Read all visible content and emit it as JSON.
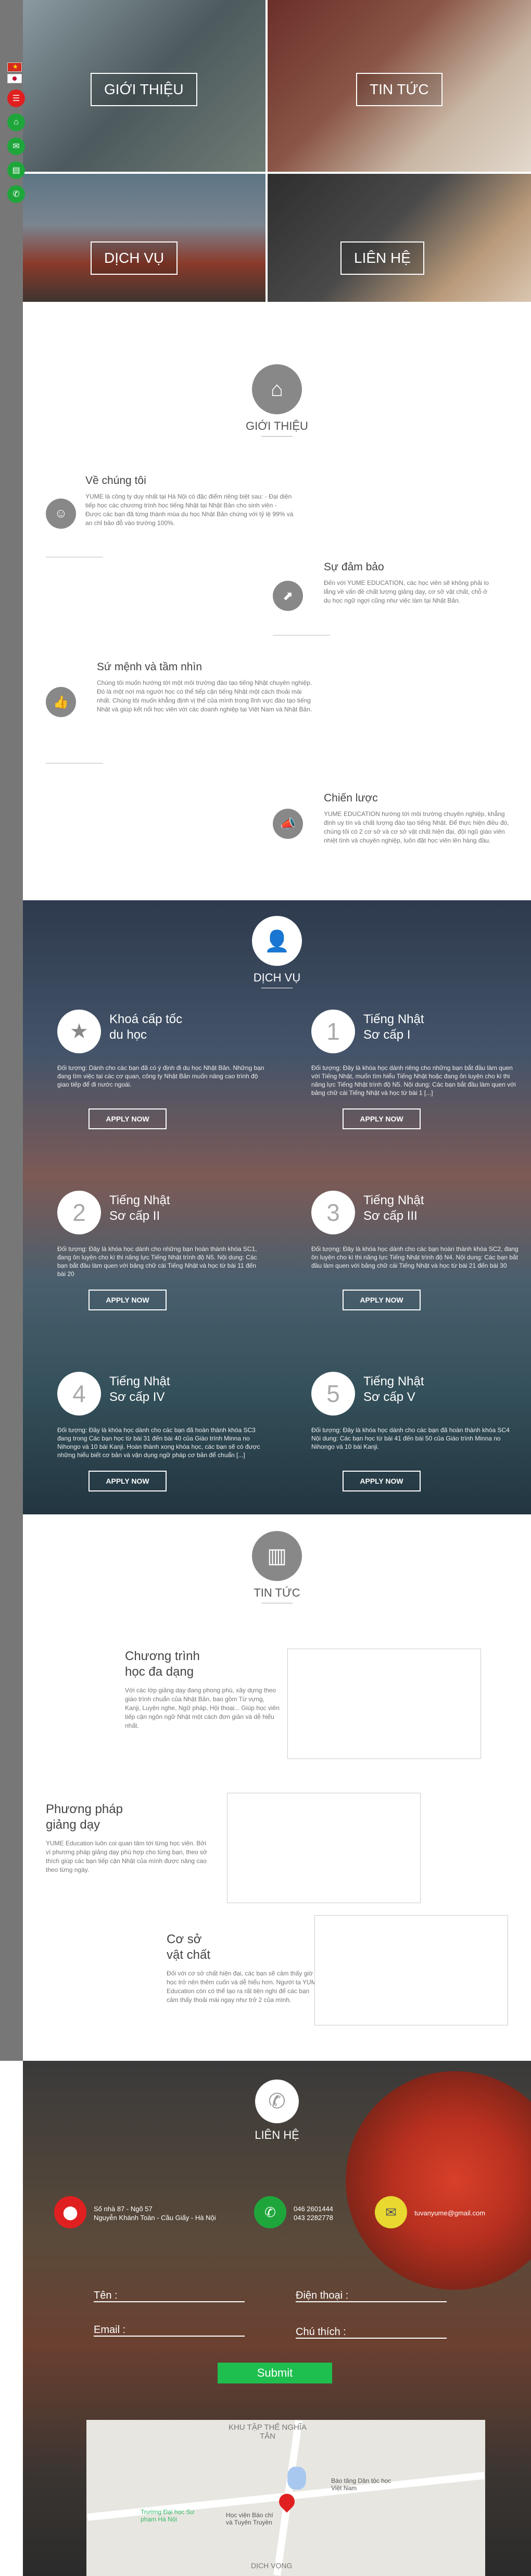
{
  "rail": {
    "icons": [
      "flag-vietnam",
      "flag-japan",
      "menu-icon",
      "home-icon",
      "mail-icon",
      "book-icon",
      "phone-icon"
    ]
  },
  "hero": {
    "tiles": [
      {
        "label": "GIỚI THIỆU"
      },
      {
        "label": "TIN TỨC"
      },
      {
        "label": "DỊCH VỤ"
      },
      {
        "label": "LIÊN HỆ"
      }
    ]
  },
  "about": {
    "title": "GIỚI THIỆU",
    "items": [
      {
        "title": "Về chúng tôi",
        "text": "YUME là công ty duy nhất tại Hà Nội có đặc điểm riêng biệt sau: - Đại diện tiếp học các chương trình học tiếng Nhật tại Nhật Bản cho sinh viên - Được các bạn đã từng thành mùa du học Nhật Bản chứng với tỷ lệ 99% và an chỉ bảo đỗ vào trường 100%."
      },
      {
        "title": "Sự đảm bảo",
        "text": "Đến với YUME EDUCATION, các học viên sẽ không phải lo lắng về vấn đề chất lượng giảng dạy, cơ sở vật chất, chỗ ở du học ngữ ngợi cũng như việc làm tại Nhật Bản."
      },
      {
        "title": "Sứ mệnh và tầm nhìn",
        "text": "Chúng tôi muốn hướng tới một môi trường đào tạo tiếng Nhật chuyên nghiệp. Đó là một nơi mà người học có thể tiếp cận tiếng Nhật một cách thoải mái nhất. Chúng tôi muốn khẳng định vị thế của mình trong lĩnh vực đào tạo tiếng Nhật và giúp kết nối học viên với các doanh nghiệp tại Việt Nam và Nhật Bản."
      },
      {
        "title": "Chiến lược",
        "text": "YUME EDUCATION hướng tới môi trường chuyên nghiệp, khẳng định uy tín và chất lượng đào tạo tiếng Nhật. Để thực hiện điều đó, chúng tôi có 2 cơ sở và cơ sở vật chất hiện đại, đội ngũ giáo viên nhiệt tình và chuyên nghiệp, luôn đặt học viên lên hàng đầu."
      }
    ]
  },
  "services": {
    "title": "DỊCH VỤ",
    "apply_label": "APPLY NOW",
    "items": [
      {
        "num": "★",
        "title_l1": "Khoá cấp tốc",
        "title_l2": "du học",
        "text": "Đối tượng: Dành cho các bạn đã có ý định đi du học Nhật Bản. Những bạn đang tìm việc tại các cơ quan, công ty Nhật Bản muốn nâng cao trình độ giao tiếp để đi nước ngoài."
      },
      {
        "num": "1",
        "title_l1": "Tiếng Nhật",
        "title_l2": "Sơ cấp I",
        "text": "Đối tượng: Đây là khóa học dành riêng cho những bạn bắt đầu làm quen với Tiếng Nhật, muốn tìm hiểu Tiếng Nhật hoặc đang ôn luyện cho kì thi năng lực Tiếng Nhật trình độ N5. Nội dung: Các bạn bắt đầu làm quen với bảng chữ cái Tiếng Nhật và học từ bài 1 [...]"
      },
      {
        "num": "2",
        "title_l1": "Tiếng Nhật",
        "title_l2": "Sơ cấp II",
        "text": "Đối tượng: Đây là khóa học dành cho những bạn hoàn thành khóa SC1, đang ôn luyện cho kì thi năng lực Tiếng Nhật trình độ N5. Nội dung: Các bạn bắt đầu làm quen với bảng chữ cái Tiếng Nhật và học từ bài 11 đến bài 20"
      },
      {
        "num": "3",
        "title_l1": "Tiếng Nhật",
        "title_l2": "Sơ cấp III",
        "text": "Đối tượng: Đây là khóa học dành cho các bạn hoàn thành khóa SC2, đang ôn luyện cho kì thi năng lực Tiếng Nhật trình độ N4. Nội dung: Các bạn bắt đầu làm quen với bảng chữ cái Tiếng Nhật và học từ bài 21 đến bài 30"
      },
      {
        "num": "4",
        "title_l1": "Tiếng Nhật",
        "title_l2": "Sơ cấp IV",
        "text": "Đối tượng: Đây là khóa học dành cho các bạn đã hoàn thành khóa SC3 đang trong Các bạn học từ bài 31 đến bài 40 của Giáo trình Minna no Nihongo và 10 bài Kanji. Hoàn thành xong khóa học, các bạn sẽ có được những hiểu biết cơ bản và vận dụng ngữ pháp cơ bản để chuẩn [...]"
      },
      {
        "num": "5",
        "title_l1": "Tiếng Nhật",
        "title_l2": "Sơ cấp V",
        "text": "Đối tượng: Đây là khóa học dành cho các bạn đã hoàn thành khóa SC4 Nội dung: Các bạn học từ bài 41 đến bài 50 của Giáo trình Minna no Nihongo và 10 bài Kanji."
      }
    ]
  },
  "news": {
    "title": "TIN TỨC",
    "items": [
      {
        "title_l1": "Chương trình",
        "title_l2": "học đa dạng",
        "text": "Với các lớp giảng dạy đang phong phú, xây dựng theo giáo trình chuẩn của Nhật Bản, bao gồm Từ vựng, Kanji, Luyện nghe, Ngữ pháp, Hội thoại... Giúp học viên tiếp cận ngôn ngữ Nhật một cách đơn giản và dễ hiểu nhất."
      },
      {
        "title_l1": "Phương pháp",
        "title_l2": "giảng dạy",
        "text": "YUME Education luôn coi quan tâm tới từng học viên. Bởi vì phương pháp giảng dạy phù hợp cho từng bạn, theo sở thích giúp các bạn tiếp cận Nhật của mình được nâng cao theo từng ngày."
      },
      {
        "title_l1": "Cơ sở",
        "title_l2": "vật chất",
        "text": "Đối với cơ sở chất hiện đại, các bạn sẽ cảm thấy giờ học trở nên thêm cuốn và dễ hiểu hơn. Người ta YUME Education còn có thể tạo ra rất tiện nghi để các bạn cảm thấy thoải mái ngay như trở 2 của mình."
      }
    ]
  },
  "contact": {
    "title": "LIÊN HỆ",
    "address_l1": "Số nhà 87 - Ngõ 57",
    "address_l2": "Nguyễn Khánh Toàn - Cầu Giấy - Hà Nội",
    "phone_l1": "046 2601444",
    "phone_l2": "043 2282778",
    "email": "tuvanyume@gmail.com",
    "name_label": "Tên :",
    "phone_label": "Điện thoại :",
    "email_label": "Email :",
    "note_label": "Chú thích :",
    "submit_label": "Submit",
    "map_labels": {
      "area": "KHU TẬP THỂ NGHĨA TÂN",
      "school": "Trường Đại học Sư phạm Hà Nội",
      "academy": "Học viện Báo chí và Tuyên Truyền",
      "paper": "Báo tăng Dân tộc học Việt Nam",
      "district": "DỊCH VỌNG"
    }
  }
}
